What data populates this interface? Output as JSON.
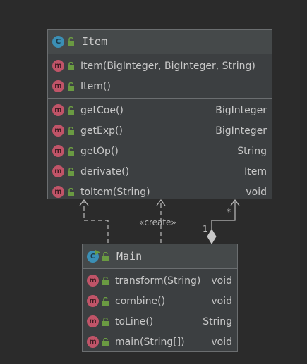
{
  "classes": {
    "item": {
      "title": "Item",
      "icon": "class-icon",
      "constructors": [
        {
          "name": "Item(BigInteger, BigInteger, String)",
          "type": ""
        },
        {
          "name": "Item()",
          "type": ""
        }
      ],
      "methods": [
        {
          "name": "getCoe()",
          "type": "BigInteger"
        },
        {
          "name": "getExp()",
          "type": "BigInteger"
        },
        {
          "name": "getOp()",
          "type": "String"
        },
        {
          "name": "derivate()",
          "type": "Item"
        },
        {
          "name": "toItem(String)",
          "type": "void"
        }
      ]
    },
    "main": {
      "title": "Main",
      "icon": "runnable-class-icon",
      "methods": [
        {
          "name": "transform(String)",
          "type": "void"
        },
        {
          "name": "combine()",
          "type": "void"
        },
        {
          "name": "toLine()",
          "type": "String"
        },
        {
          "name": "main(String[])",
          "type": "void"
        }
      ]
    }
  },
  "relations": {
    "create_label": "«create»",
    "multiplicity_source": "1",
    "multiplicity_target": "*"
  },
  "icons": {
    "class_letter": "C",
    "method_letter": "m"
  },
  "colors": {
    "background": "#2b2b2b",
    "class_icon": "#3b8fb5",
    "method_icon": "#c05468",
    "lock": "#6a9a42"
  }
}
